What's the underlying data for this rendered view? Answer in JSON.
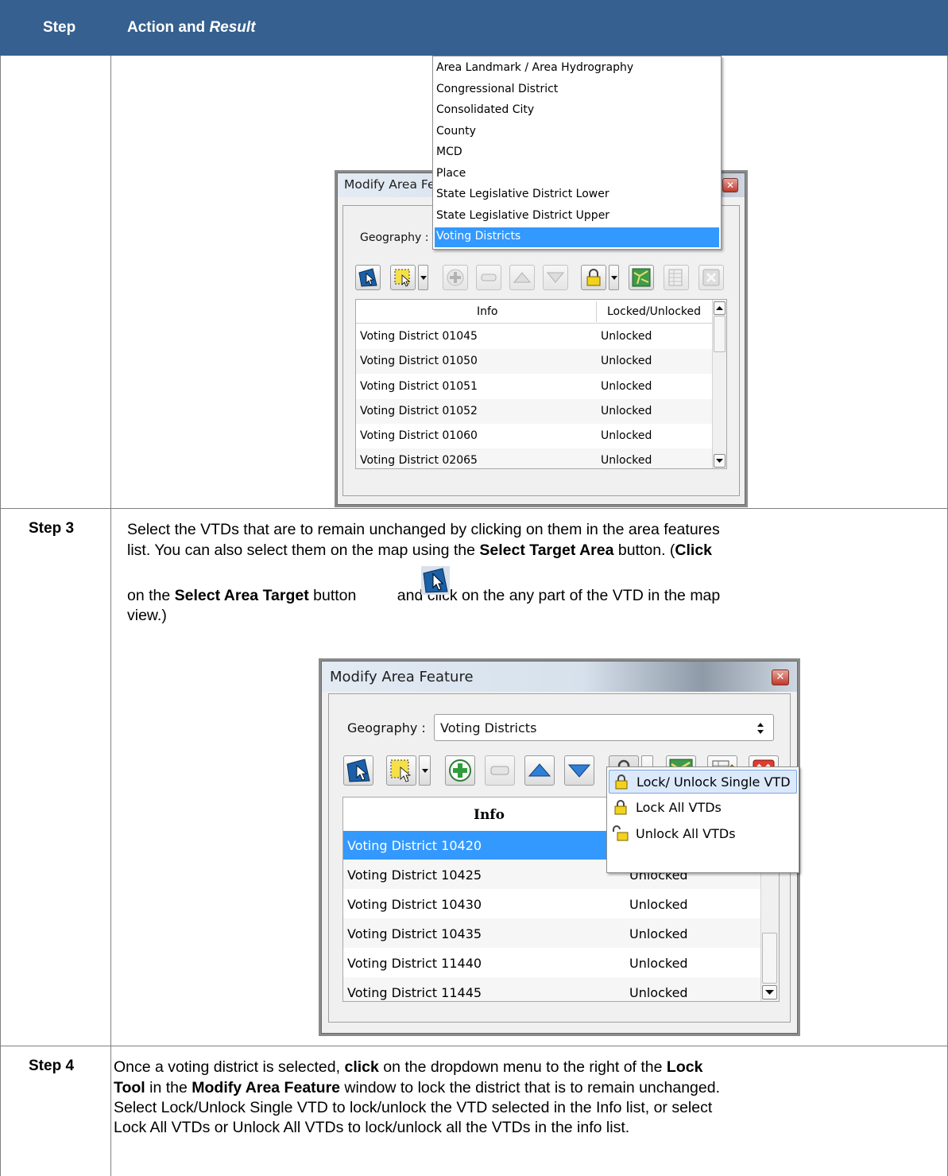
{
  "table": {
    "header": {
      "step": "Step",
      "action_prefix": "Action and ",
      "action_italic": "Result"
    },
    "rows": [
      {
        "label": ""
      },
      {
        "label": "Step 3",
        "p1": "Select the VTDs that are to remain unchanged by clicking on them in the area features",
        "p2a": "list. You can also select them on the map using the ",
        "p2b": "Select Target Area",
        "p2c": " button. (",
        "p2d": "Click",
        "p3a": "on the ",
        "p3b": "Select Area Target",
        "p3c": " button",
        "p3d": " and click on the any part of the VTD in the map",
        "p4": "view.)"
      },
      {
        "label": "Step 4",
        "l1a": "Once a voting district is selected, ",
        "l1b": "click",
        "l1c": " on the dropdown menu to the right of the ",
        "l1d": "Lock",
        "l2a": "Tool",
        "l2b": " in the ",
        "l2c": "Modify Area Feature",
        "l2d": " window to lock the district that is to remain unchanged.",
        "l3": "Select Lock/Unlock Single VTD to lock/unlock the VTD selected in the Info list, or select",
        "l4": "Lock All VTDs or Unlock All VTDs to lock/unlock all the VTDs in the info list."
      }
    ]
  },
  "dialog1": {
    "title": "Modify Area Fe",
    "geography_label": "Geography :",
    "geography_options": [
      "Area Landmark / Area Hydrography",
      "Congressional District",
      "Consolidated City",
      "County",
      "MCD",
      "Place",
      "State Legislative District Lower",
      "State Legislative District Upper",
      "Voting Districts"
    ],
    "selected_option": "Voting Districts",
    "columns": [
      "Info",
      "Locked/Unlocked"
    ],
    "rows": [
      [
        "Voting District 01045",
        "Unlocked"
      ],
      [
        "Voting District 01050",
        "Unlocked"
      ],
      [
        "Voting District 01051",
        "Unlocked"
      ],
      [
        "Voting District 01052",
        "Unlocked"
      ],
      [
        "Voting District 01060",
        "Unlocked"
      ],
      [
        "Voting District 02065",
        "Unlocked"
      ]
    ]
  },
  "dialog2": {
    "title": "Modify Area Feature",
    "geography_label": "Geography :",
    "geography_value": "Voting Districts",
    "columns": [
      "Info"
    ],
    "rows": [
      [
        "Voting District 10420",
        ""
      ],
      [
        "Voting District 10425",
        "Unlocked"
      ],
      [
        "Voting District 10430",
        "Unlocked"
      ],
      [
        "Voting District 10435",
        "Unlocked"
      ],
      [
        "Voting District 11440",
        "Unlocked"
      ],
      [
        "Voting District 11445",
        "Unlocked"
      ]
    ],
    "lock_menu": [
      "Lock/ Unlock Single VTD",
      "Lock All VTDs",
      "Unlock All VTDs"
    ]
  },
  "colors": {
    "header_bg": "#35608f",
    "selection": "#3399ff",
    "menu_highlight": "#dbe9fb"
  }
}
